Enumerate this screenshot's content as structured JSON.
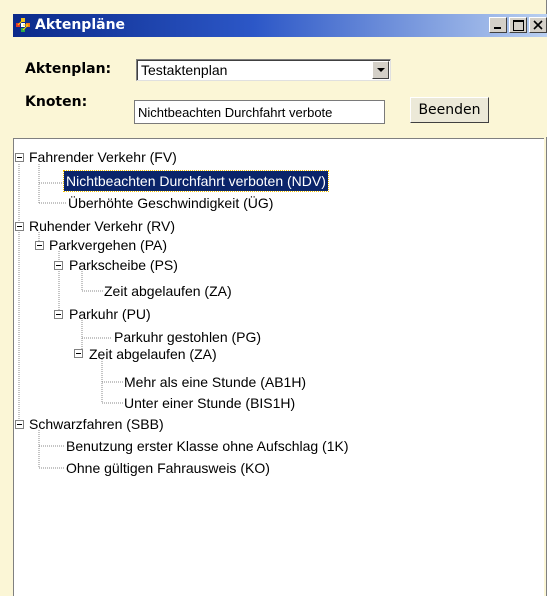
{
  "window": {
    "title": "Aktenpläne",
    "icon": "app-icon",
    "controls": [
      "minimize",
      "maximize",
      "close"
    ]
  },
  "form": {
    "aktenplan_label": "Aktenplan:",
    "aktenplan_value": "Testaktenplan",
    "knoten_label": "Knoten:",
    "knoten_value": "Nichtbeachten Durchfahrt verbote",
    "beenden_label": "Beenden"
  },
  "tree": {
    "selected": "Nichtbeachten Durchfahrt verboten (NDV)",
    "nodes": [
      {
        "label": "Fahrender Verkehr (FV)",
        "level": 0,
        "expanded": true
      },
      {
        "label": "Nichtbeachten Durchfahrt verboten (NDV)",
        "level": 1
      },
      {
        "label": "Überhöhte Geschwindigkeit (ÜG)",
        "level": 1
      },
      {
        "label": "Ruhender Verkehr (RV)",
        "level": 0,
        "expanded": true
      },
      {
        "label": "Parkvergehen (PA)",
        "level": 1,
        "expanded": true
      },
      {
        "label": "Parkscheibe (PS)",
        "level": 2,
        "expanded": true
      },
      {
        "label": "Zeit abgelaufen (ZA)",
        "level": 3
      },
      {
        "label": "Parkuhr (PU)",
        "level": 2,
        "expanded": true
      },
      {
        "label": "Parkuhr gestohlen (PG)",
        "level": 3
      },
      {
        "label": "Zeit abgelaufen (ZA)",
        "level": 3,
        "expanded": true
      },
      {
        "label": "Mehr als eine Stunde (AB1H)",
        "level": 4
      },
      {
        "label": "Unter einer Stunde (BIS1H)",
        "level": 4
      },
      {
        "label": "Schwarzfahren (SBB)",
        "level": 0,
        "expanded": true
      },
      {
        "label": "Benutzung erster Klasse ohne Aufschlag (1K)",
        "level": 1
      },
      {
        "label": "Ohne gültigen Fahrausweis (KO)",
        "level": 1
      }
    ]
  },
  "colors": {
    "titlebar_start": "#0b2a8a",
    "titlebar_end": "#b9cff0",
    "form_background": "#fbf6d6",
    "selection": "#0a246a"
  }
}
